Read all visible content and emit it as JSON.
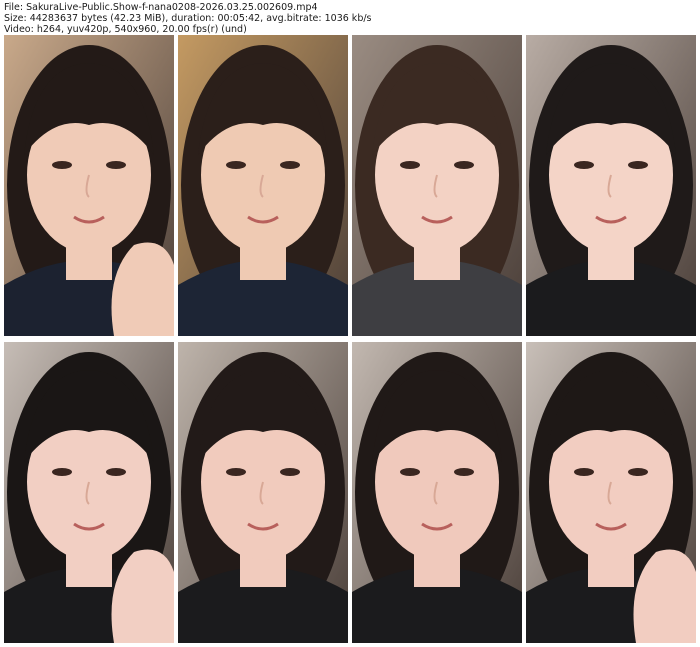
{
  "header": {
    "line1": "File: SakuraLive-Public.Show-f-nana0208-2026.03.25.002609.mp4",
    "line2": "Size: 44283637 bytes (42.23 MiB), duration: 00:05:42, avg.bitrate: 1036 kb/s",
    "line3": "Video: h264, yuv420p, 540x960, 20.00 fps(r) (und)"
  },
  "thumbnails": [
    {
      "bg": "#c9a98a",
      "skin": "#f0cbb7",
      "hair": "#231a17",
      "shirt": "#1c2230",
      "hand": true
    },
    {
      "bg": "#c49a62",
      "skin": "#efcab3",
      "hair": "#2b1f1a",
      "shirt": "#1d2535",
      "hand": false
    },
    {
      "bg": "#9a8c82",
      "skin": "#f3d2c4",
      "hair": "#3b2a22",
      "shirt": "#3e3e42",
      "hand": false
    },
    {
      "bg": "#b8aca4",
      "skin": "#f4d4c7",
      "hair": "#1f1a19",
      "shirt": "#1b1b1d",
      "hand": false
    },
    {
      "bg": "#c6bdb6",
      "skin": "#f2cfc3",
      "hair": "#1a1615",
      "shirt": "#1a1a1c",
      "hand": true
    },
    {
      "bg": "#beb4ab",
      "skin": "#f1cbbd",
      "hair": "#221a18",
      "shirt": "#1b1b1d",
      "hand": false
    },
    {
      "bg": "#c2b8b0",
      "skin": "#f0c9bc",
      "hair": "#201917",
      "shirt": "#1b1b1d",
      "hand": false
    },
    {
      "bg": "#c8bfb8",
      "skin": "#f2cdc1",
      "hair": "#1e1816",
      "shirt": "#1b1b1d",
      "hand": true
    }
  ]
}
